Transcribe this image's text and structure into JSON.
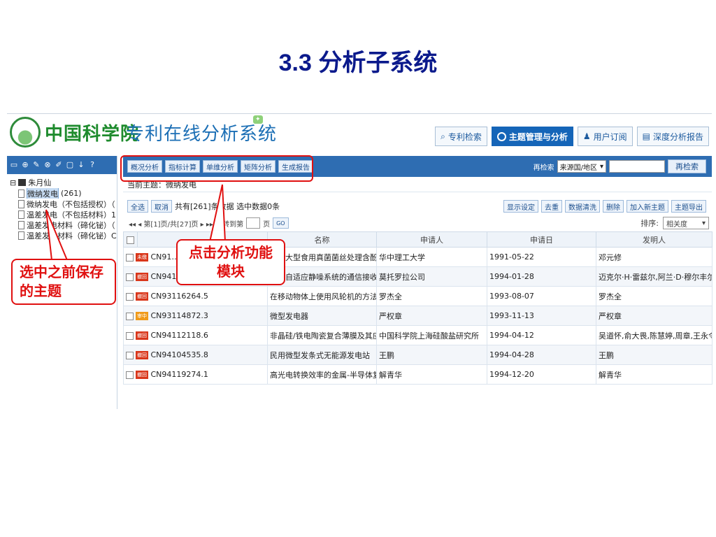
{
  "slide": {
    "title": "3.3 分析子系统"
  },
  "header": {
    "org": "中国科学院",
    "system": "专利在线分析系统",
    "nav": [
      {
        "label": "专利检索"
      },
      {
        "label": "主题管理与分析"
      },
      {
        "label": "用户订阅"
      },
      {
        "label": "深度分析报告"
      }
    ]
  },
  "sidebar": {
    "root": "朱月仙",
    "items": [
      {
        "label": "微纳发电",
        "count": "(261)"
      },
      {
        "label": "微纳发电（不包括授权）（"
      },
      {
        "label": "温差发电（不包括材料）1"
      },
      {
        "label": "温差发电材料（碲化铋）（"
      },
      {
        "label": "温差发电材料（碲化铋）C"
      }
    ]
  },
  "toolbar": {
    "buttons": [
      "概况分析",
      "指标计算",
      "单维分析",
      "矩阵分析",
      "生成报告"
    ],
    "search_label": "再检索",
    "search_field": "来源国/地区",
    "search_button": "再检索"
  },
  "topic": {
    "label": "当前主题：微纳发电"
  },
  "actions": {
    "select_all": "全选",
    "cancel": "取消",
    "summary": "共有[261]条数据   选中数据0条",
    "right": [
      "显示设定",
      "去重",
      "数据清洗",
      "删除",
      "加入新主题",
      "主题导出"
    ]
  },
  "pager": {
    "text": "◂◂  ◂  第[1]页/共[27]页  ▸  ▸▸  跳转到第",
    "page_suffix": "页",
    "go": "GO",
    "sort_label": "排序:",
    "sort_value": "相关度"
  },
  "table": {
    "columns": [
      "",
      "",
      "名称",
      "申请人",
      "申请日",
      "发明人"
    ],
    "rows": [
      {
        "status": "未缴",
        "pn": "CN91…",
        "title": "…化大型食用真菌菌丝处理含酚废水",
        "applicant": "华中理工大学",
        "date": "1991-05-22",
        "inventor": "邓元修"
      },
      {
        "status": "撤回",
        "pn": "CN94101109.7",
        "title": "带有自适应静噪系统的通信接收机",
        "applicant": "莫托罗拉公司",
        "date": "1994-01-28",
        "inventor": "迈克尔·H·雷兹尔,阿兰·D·穆尔丰尔德"
      },
      {
        "status": "撤回",
        "pn": "CN93116264.5",
        "title": "在移动物体上使用风轮机的方法",
        "applicant": "罗杰全",
        "date": "1993-08-07",
        "inventor": "罗杰全"
      },
      {
        "status": "审中",
        "pn": "CN93114872.3",
        "title": "微型发电器",
        "applicant": "严权章",
        "date": "1993-11-13",
        "inventor": "严权章"
      },
      {
        "status": "撤回",
        "pn": "CN94112118.6",
        "title": "非晶硅/铁电陶瓷复合薄膜及其应用",
        "applicant": "中国科学院上海硅酸盐研究所",
        "date": "1994-04-12",
        "inventor": "吴道怀,俞大畏,陈慧婷,周章,王永令"
      },
      {
        "status": "撤回",
        "pn": "CN94104535.8",
        "title": "民用微型发条式无能源发电站",
        "applicant": "王鹏",
        "date": "1994-04-28",
        "inventor": "王鹏"
      },
      {
        "status": "撤回",
        "pn": "CN94119274.1",
        "title": "高光电转换效率的金属-半导体复合膜",
        "applicant": "解青华",
        "date": "1994-12-20",
        "inventor": "解青华"
      }
    ]
  },
  "annotations": {
    "callout_saved": "选中之前保存的主题",
    "callout_analysis": "点击分析功能模块"
  },
  "colors": {
    "title": "#0b1a8c",
    "toolbar": "#2e6db2",
    "annotation": "#e01010",
    "cas_green": "#1e8b2d"
  }
}
